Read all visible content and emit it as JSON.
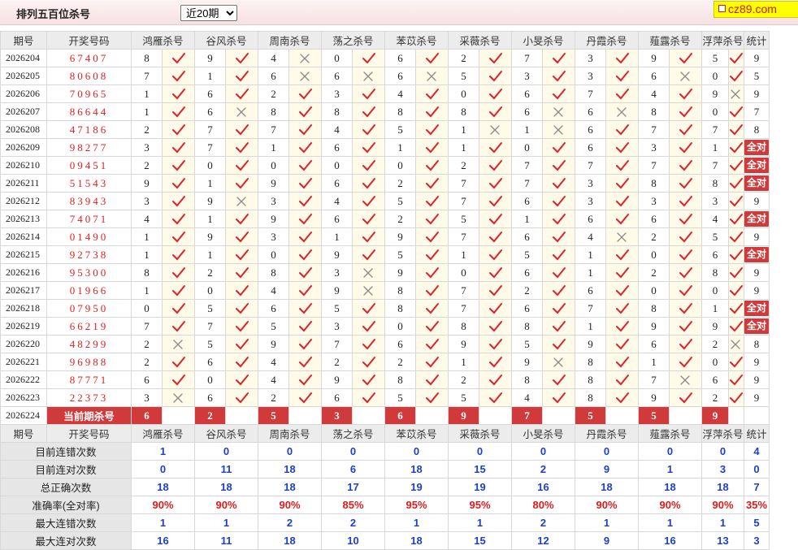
{
  "header": {
    "title": "排列五百位杀号",
    "period_select": "近20期",
    "period_options": [
      "近20期"
    ],
    "logo_text": "cz89.com"
  },
  "columns": {
    "issue": "期号",
    "draw": "开奖号码",
    "experts": [
      "鸿雁杀号",
      "谷风杀号",
      "周南杀号",
      "荡之杀号",
      "苯苡杀号",
      "采薇杀号",
      "小旻杀号",
      "丹霞杀号",
      "薤露杀号",
      "浮萍杀号"
    ],
    "total": "统计"
  },
  "rows": [
    {
      "issue": "2026204",
      "draw": "67407",
      "picks": [
        8,
        9,
        4,
        0,
        6,
        2,
        7,
        3,
        9,
        5
      ],
      "ok": [
        1,
        1,
        0,
        1,
        1,
        1,
        1,
        1,
        1,
        1
      ],
      "total": "9"
    },
    {
      "issue": "2026205",
      "draw": "80608",
      "picks": [
        7,
        1,
        6,
        6,
        6,
        5,
        3,
        3,
        6,
        0
      ],
      "ok": [
        1,
        1,
        0,
        0,
        0,
        1,
        1,
        1,
        0,
        1
      ],
      "total": "5"
    },
    {
      "issue": "2026206",
      "draw": "70965",
      "picks": [
        1,
        6,
        2,
        3,
        4,
        0,
        6,
        7,
        4,
        9
      ],
      "ok": [
        1,
        1,
        1,
        1,
        1,
        1,
        1,
        1,
        1,
        0
      ],
      "total": "9"
    },
    {
      "issue": "2026207",
      "draw": "86644",
      "picks": [
        1,
        6,
        8,
        8,
        8,
        8,
        6,
        6,
        8,
        0
      ],
      "ok": [
        1,
        0,
        1,
        1,
        1,
        1,
        0,
        0,
        1,
        1
      ],
      "total": "7"
    },
    {
      "issue": "2026208",
      "draw": "47186",
      "picks": [
        2,
        7,
        7,
        4,
        5,
        1,
        1,
        6,
        7,
        7
      ],
      "ok": [
        1,
        1,
        1,
        1,
        1,
        0,
        0,
        1,
        1,
        1
      ],
      "total": "8"
    },
    {
      "issue": "2026209",
      "draw": "98277",
      "picks": [
        3,
        7,
        1,
        6,
        1,
        1,
        0,
        6,
        3,
        1
      ],
      "ok": [
        1,
        1,
        1,
        1,
        1,
        1,
        1,
        1,
        1,
        1
      ],
      "total": "全对"
    },
    {
      "issue": "2026210",
      "draw": "09451",
      "picks": [
        2,
        0,
        0,
        0,
        0,
        2,
        7,
        7,
        7,
        7
      ],
      "ok": [
        1,
        1,
        1,
        1,
        1,
        1,
        1,
        1,
        1,
        1
      ],
      "total": "全对"
    },
    {
      "issue": "2026211",
      "draw": "51543",
      "picks": [
        9,
        1,
        9,
        6,
        2,
        7,
        7,
        3,
        8,
        8
      ],
      "ok": [
        1,
        1,
        1,
        1,
        1,
        1,
        1,
        1,
        1,
        1
      ],
      "total": "全对"
    },
    {
      "issue": "2026212",
      "draw": "83943",
      "picks": [
        3,
        9,
        3,
        4,
        5,
        7,
        6,
        3,
        3,
        3
      ],
      "ok": [
        1,
        0,
        1,
        1,
        1,
        1,
        1,
        1,
        1,
        1
      ],
      "total": "9"
    },
    {
      "issue": "2026213",
      "draw": "74071",
      "picks": [
        4,
        1,
        9,
        6,
        2,
        5,
        1,
        6,
        6,
        4
      ],
      "ok": [
        1,
        1,
        1,
        1,
        1,
        1,
        1,
        1,
        1,
        1
      ],
      "total": "全对"
    },
    {
      "issue": "2026214",
      "draw": "01490",
      "picks": [
        1,
        9,
        3,
        1,
        9,
        7,
        6,
        4,
        2,
        5
      ],
      "ok": [
        1,
        1,
        1,
        1,
        1,
        1,
        1,
        0,
        1,
        1
      ],
      "total": "9"
    },
    {
      "issue": "2026215",
      "draw": "92738",
      "picks": [
        1,
        1,
        0,
        9,
        5,
        1,
        5,
        1,
        0,
        6
      ],
      "ok": [
        1,
        1,
        1,
        1,
        1,
        1,
        1,
        1,
        1,
        1
      ],
      "total": "全对"
    },
    {
      "issue": "2026216",
      "draw": "95300",
      "picks": [
        8,
        2,
        8,
        3,
        9,
        0,
        6,
        1,
        2,
        8
      ],
      "ok": [
        1,
        1,
        1,
        0,
        1,
        1,
        1,
        1,
        1,
        1
      ],
      "total": "9"
    },
    {
      "issue": "2026217",
      "draw": "01966",
      "picks": [
        1,
        0,
        4,
        9,
        8,
        7,
        2,
        6,
        0,
        0
      ],
      "ok": [
        1,
        1,
        1,
        0,
        1,
        1,
        1,
        1,
        1,
        1
      ],
      "total": "9"
    },
    {
      "issue": "2026218",
      "draw": "07950",
      "picks": [
        0,
        5,
        6,
        5,
        8,
        7,
        6,
        7,
        8,
        1
      ],
      "ok": [
        1,
        1,
        1,
        1,
        1,
        1,
        1,
        1,
        1,
        1
      ],
      "total": "全对"
    },
    {
      "issue": "2026219",
      "draw": "66219",
      "picks": [
        7,
        7,
        5,
        3,
        0,
        8,
        8,
        1,
        9,
        9
      ],
      "ok": [
        1,
        1,
        1,
        1,
        1,
        1,
        1,
        1,
        1,
        1
      ],
      "total": "全对"
    },
    {
      "issue": "2026220",
      "draw": "48299",
      "picks": [
        2,
        5,
        9,
        7,
        6,
        9,
        5,
        9,
        6,
        2
      ],
      "ok": [
        0,
        1,
        1,
        1,
        1,
        1,
        1,
        1,
        1,
        0
      ],
      "total": "8"
    },
    {
      "issue": "2026221",
      "draw": "96988",
      "picks": [
        2,
        6,
        4,
        2,
        2,
        1,
        9,
        8,
        1,
        0
      ],
      "ok": [
        1,
        1,
        1,
        1,
        1,
        1,
        0,
        1,
        1,
        1
      ],
      "total": "9"
    },
    {
      "issue": "2026222",
      "draw": "87771",
      "picks": [
        6,
        0,
        4,
        9,
        8,
        2,
        8,
        8,
        7,
        6
      ],
      "ok": [
        1,
        1,
        1,
        1,
        1,
        1,
        1,
        1,
        0,
        1
      ],
      "total": "9"
    },
    {
      "issue": "2026223",
      "draw": "22373",
      "picks": [
        3,
        6,
        2,
        6,
        5,
        5,
        4,
        8,
        9,
        2
      ],
      "ok": [
        0,
        1,
        1,
        1,
        1,
        1,
        1,
        1,
        1,
        1
      ],
      "total": "9"
    }
  ],
  "current": {
    "issue": "2026224",
    "label": "当前期杀号",
    "picks": [
      "6",
      "2",
      "5",
      "3",
      "6",
      "9",
      "7",
      "5",
      "5",
      "9"
    ]
  },
  "stats": [
    {
      "label": "目前连错次数",
      "values": [
        "1",
        "0",
        "0",
        "0",
        "0",
        "0",
        "0",
        "0",
        "0",
        "0"
      ],
      "total": "4",
      "kind": "count"
    },
    {
      "label": "目前连对次数",
      "values": [
        "0",
        "11",
        "18",
        "6",
        "18",
        "15",
        "2",
        "9",
        "1",
        "3"
      ],
      "total": "0",
      "kind": "count"
    },
    {
      "label": "总正确次数",
      "values": [
        "18",
        "18",
        "18",
        "17",
        "19",
        "19",
        "16",
        "18",
        "18",
        "18"
      ],
      "total": "7",
      "kind": "count"
    },
    {
      "label": "准确率(全对率)",
      "values": [
        "90%",
        "90%",
        "90%",
        "85%",
        "95%",
        "95%",
        "80%",
        "90%",
        "90%",
        "90%"
      ],
      "total": "35%",
      "kind": "rate"
    },
    {
      "label": "最大连错次数",
      "values": [
        "1",
        "1",
        "2",
        "2",
        "1",
        "1",
        "2",
        "1",
        "1",
        "1"
      ],
      "total": "5",
      "kind": "count"
    },
    {
      "label": "最大连对次数",
      "values": [
        "16",
        "11",
        "18",
        "10",
        "18",
        "15",
        "12",
        "9",
        "16",
        "13"
      ],
      "total": "3",
      "kind": "count"
    }
  ],
  "colors": {
    "draw_red": "#e02020",
    "badge_red": "#d03a3a",
    "check_red": "#e0202a",
    "cross_gray": "#8a8a8a",
    "stat_blue": "#1e3fc8"
  }
}
